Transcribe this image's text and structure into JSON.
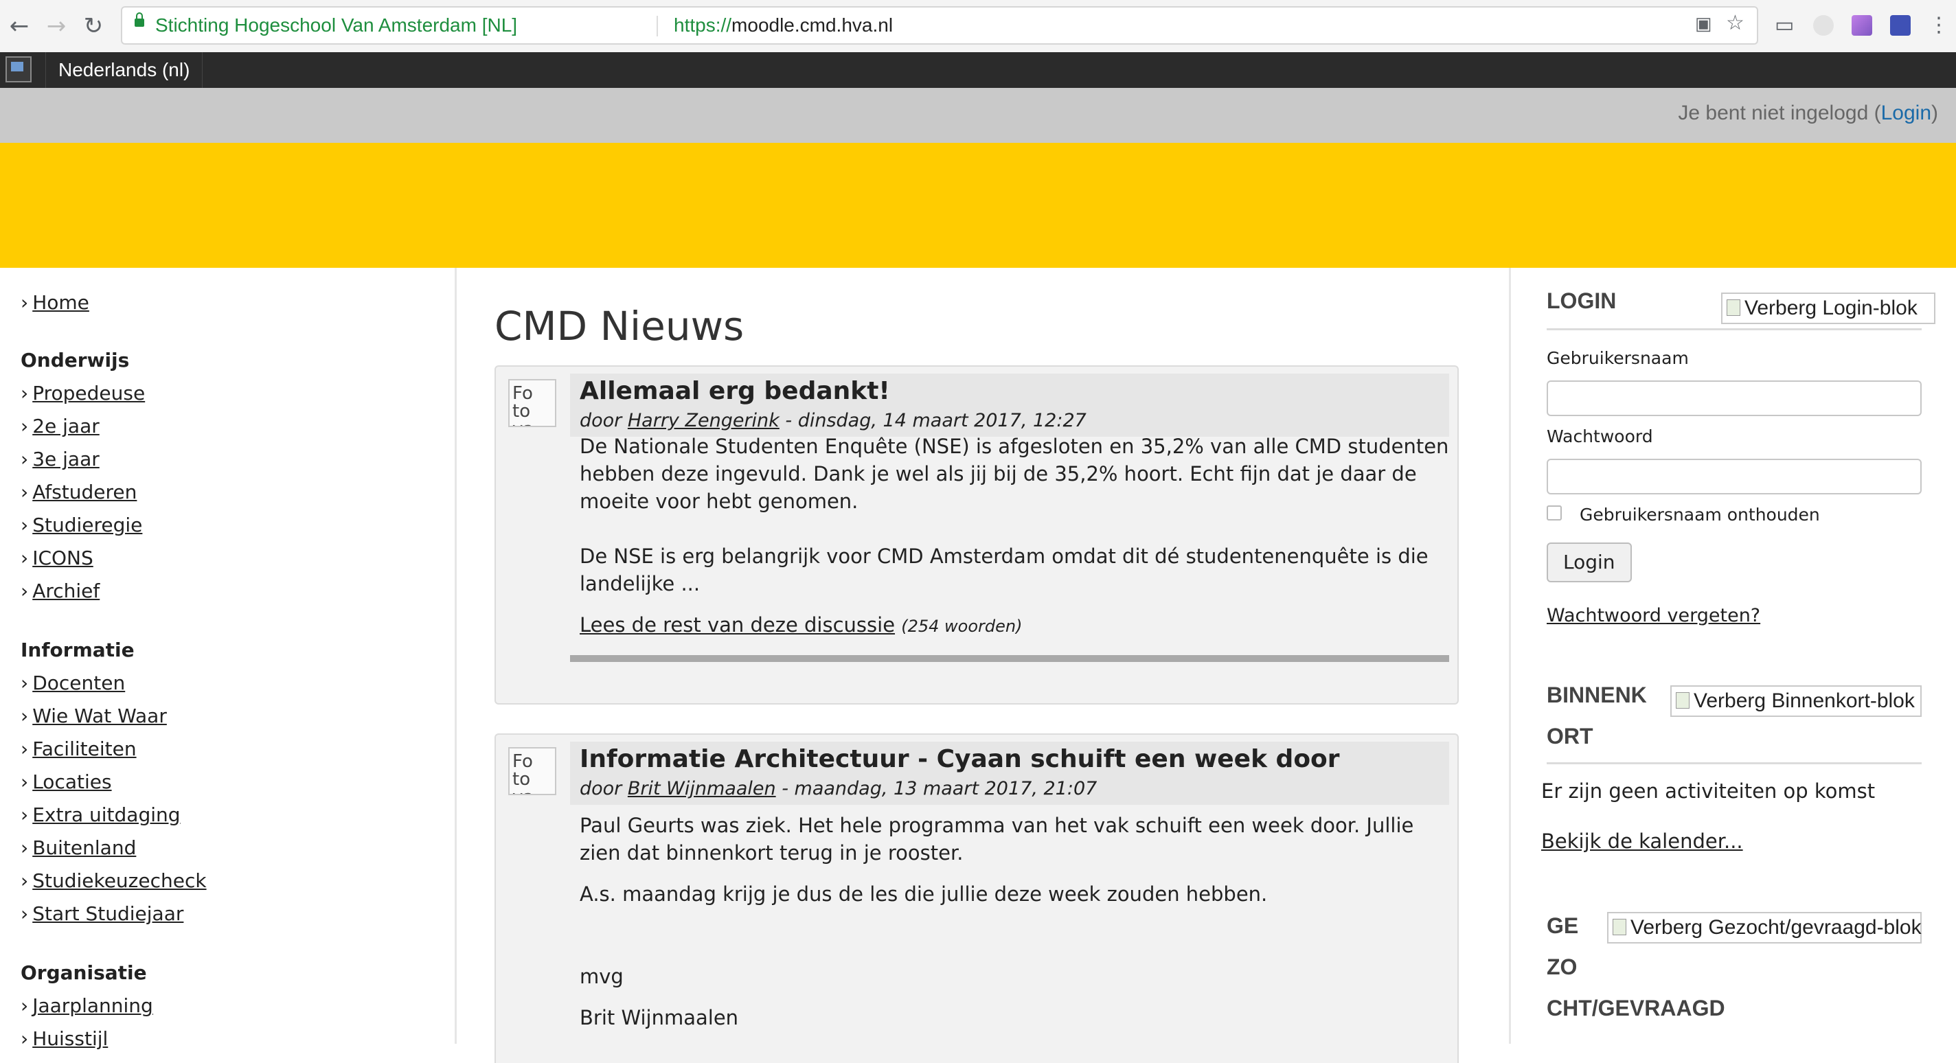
{
  "browser": {
    "org_label": "Stichting Hogeschool Van Amsterdam [NL]",
    "url_scheme": "https://",
    "url_host": "moodle.cmd.hva.nl"
  },
  "navbar": {
    "language": "Nederlands (nl)"
  },
  "loginbar": {
    "prefix": "Je bent niet ingelogd (",
    "link": "Login",
    "suffix": ")"
  },
  "sidebar": {
    "home": "Home",
    "sections": [
      {
        "heading": "Onderwijs",
        "items": [
          "Propedeuse",
          "2e jaar",
          "3e jaar",
          "Afstuderen",
          "Studieregie",
          "ICONS",
          "Archief"
        ]
      },
      {
        "heading": "Informatie",
        "items": [
          "Docenten",
          "Wie Wat Waar",
          "Faciliteiten",
          "Locaties",
          "Extra uitdaging",
          "Buitenland",
          "Studiekeuzecheck",
          "Start Studiejaar"
        ]
      },
      {
        "heading": "Organisatie",
        "items": [
          "Jaarplanning",
          "Huisstijl"
        ]
      }
    ]
  },
  "main": {
    "title": "CMD Nieuws",
    "posts": [
      {
        "picture_alt": "Fo to va",
        "subject": "Allemaal erg bedankt!",
        "by_prefix": "door ",
        "author": "Harry Zengerink",
        "date": " - dinsdag, 14 maart 2017, 12:27",
        "paragraphs": [
          "De Nationale Studenten Enquête (NSE) is afgesloten en 35,2% van alle CMD studenten hebben deze ingevuld. Dank je wel als jij bij de 35,2% hoort. Echt fijn dat je daar de moeite voor hebt genomen.",
          "De NSE is erg belangrijk voor CMD Amsterdam omdat dit dé studentenenquête is die landelijke ..."
        ],
        "read_more": "Lees de rest van deze discussie",
        "word_count": "(254 woorden)"
      },
      {
        "picture_alt": "Fo to va",
        "subject": "Informatie Architectuur - Cyaan schuift een week door",
        "by_prefix": "door ",
        "author": "Brit Wijnmaalen",
        "date": " - maandag, 13 maart 2017, 21:07",
        "paragraphs": [
          "Paul Geurts was ziek. Het hele programma van het vak schuift een week door. Jullie zien dat binnenkort terug in je rooster.",
          "A.s. maandag krijg je dus de les die jullie deze week zouden hebben.",
          "mvg",
          "Brit Wijnmaalen"
        ]
      }
    ]
  },
  "right": {
    "login": {
      "title": "LOGIN",
      "hide_alt": "Verberg Login-blok",
      "username_label": "Gebruikersnaam",
      "password_label": "Wachtwoord",
      "remember_label": "Gebruikersnaam onthouden",
      "button": "Login",
      "forgot": "Wachtwoord vergeten?"
    },
    "upcoming": {
      "title_line1": "BINNENK",
      "title_line2": "ORT",
      "hide_alt": "Verberg Binnenkort-blok",
      "empty": "Er zijn geen activiteiten op komst",
      "calendar_link": "Bekijk de kalender..."
    },
    "wanted": {
      "title_line1": "GE",
      "title_line2": "ZO",
      "title_line3": "CHT/GEVRAAGD",
      "hide_alt": "Verberg Gezocht/gevraagd-blok"
    }
  },
  "colors": {
    "banner": "#ffcc00",
    "navbar": "#2b2b2b",
    "loginbar": "#c9c9c9",
    "link_blue": "#1a6aa8"
  }
}
